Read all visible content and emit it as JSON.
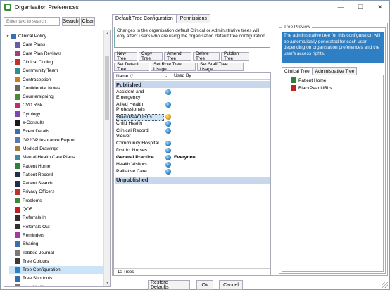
{
  "window": {
    "title": "Organisation Preferences",
    "controls": {
      "minimize": "—",
      "maximize": "☐",
      "close": "✕"
    }
  },
  "left": {
    "search_placeholder": "Enter text to search",
    "search_label": "Search",
    "clear_label": "Clear",
    "tree": [
      {
        "label": "Clinical Policy",
        "color": "#3a6fb0",
        "expand": "▾"
      },
      {
        "label": "Care Plans",
        "color": "#6a5aa8",
        "expand": ""
      },
      {
        "label": "Care Plan Reviews",
        "color": "#a0407a",
        "expand": ""
      },
      {
        "label": "Clinical Coding",
        "color": "#c23030",
        "expand": "›"
      },
      {
        "label": "Community Team",
        "color": "#2f8f8f",
        "expand": ""
      },
      {
        "label": "Contraception",
        "color": "#d07a1a",
        "expand": ""
      },
      {
        "label": "Confidential Notes",
        "color": "#666666",
        "expand": ""
      },
      {
        "label": "Countersigning",
        "color": "#4a8a3a",
        "expand": ""
      },
      {
        "label": "CVD Risk",
        "color": "#c03060",
        "expand": ""
      },
      {
        "label": "Cytology",
        "color": "#7a4ab0",
        "expand": ""
      },
      {
        "label": "e-Consults",
        "color": "#1a1a1a",
        "expand": ""
      },
      {
        "label": "Event Details",
        "color": "#3a6fb0",
        "expand": ""
      },
      {
        "label": "GP2GP Insurance Report",
        "color": "#5a7ab0",
        "expand": ""
      },
      {
        "label": "Medical Drawings",
        "color": "#a07a3a",
        "expand": ""
      },
      {
        "label": "Mental Health Care Plans",
        "color": "#3a8aa0",
        "expand": ""
      },
      {
        "label": "Patient Home",
        "color": "#2f7f3f",
        "expand": ""
      },
      {
        "label": "Patient Record",
        "color": "#20304a",
        "expand": ""
      },
      {
        "label": "Patient Search",
        "color": "#20304a",
        "expand": ""
      },
      {
        "label": "Privacy Officers",
        "color": "#c03030",
        "expand": "›"
      },
      {
        "label": "Problems",
        "color": "#3a8a3a",
        "expand": ""
      },
      {
        "label": "QOF",
        "color": "#c02020",
        "expand": ""
      },
      {
        "label": "Referrals In",
        "color": "#303030",
        "expand": ""
      },
      {
        "label": "Referrals Out",
        "color": "#303030",
        "expand": ""
      },
      {
        "label": "Reminders",
        "color": "#a03aa0",
        "expand": ""
      },
      {
        "label": "Sharing",
        "color": "#3a6fb0",
        "expand": ""
      },
      {
        "label": "Tabbed Journal",
        "color": "#7a7a7a",
        "expand": ""
      },
      {
        "label": "Tree Colours",
        "color": "#3a3a3a",
        "expand": ""
      },
      {
        "label": "Tree Configuration",
        "color": "#2f7fc4",
        "expand": "",
        "selected": true
      },
      {
        "label": "Tree Shortcuts",
        "color": "#2f6fb0",
        "expand": ""
      },
      {
        "label": "Variable Name",
        "color": "#7a7a7a",
        "expand": ""
      }
    ]
  },
  "tabs": {
    "default_tree": "Default Tree Configuration",
    "permissions": "Permissions"
  },
  "info_text": "Changes to the organisation default Clinical or Administrative trees will only affect users who are using the organisation default tree configuration.",
  "actions": {
    "new_tree": "New Tree",
    "copy_tree": "Copy Tree",
    "amend_tree": "Amend Tree",
    "delete_tree": "Delete Tree",
    "publish_tree": "Publish Tree",
    "set_default_tree": "Set Default Tree",
    "set_role_tree_usage": "Set Role Tree Usage",
    "set_staff_tree_usage": "Set Staff Tree Usage"
  },
  "grid": {
    "col_name": "Name",
    "sort_icon": "▽",
    "col_dots": "...",
    "col_used": "Used By",
    "published_label": "Published",
    "unpublished_label": "Unpublished",
    "rows": [
      {
        "name": "Accident and Emergency",
        "used_by": "",
        "bold": false,
        "selected": false,
        "warn": false,
        "lines": 2
      },
      {
        "name": "Allied Health Professionals",
        "used_by": "",
        "bold": false,
        "selected": false,
        "warn": false,
        "lines": 2
      },
      {
        "name": "BlackPear URLs",
        "used_by": "",
        "bold": false,
        "selected": true,
        "warn": true,
        "lines": 1
      },
      {
        "name": "Child Health",
        "used_by": "",
        "bold": false,
        "selected": false,
        "warn": false,
        "lines": 1
      },
      {
        "name": "Clinical Record Viewer",
        "used_by": "",
        "bold": false,
        "selected": false,
        "warn": false,
        "lines": 2
      },
      {
        "name": "Community Hospital",
        "used_by": "",
        "bold": false,
        "selected": false,
        "warn": false,
        "lines": 1
      },
      {
        "name": "District Nurses",
        "used_by": "",
        "bold": false,
        "selected": false,
        "warn": false,
        "lines": 1
      },
      {
        "name": "General Practice",
        "used_by": "Everyone",
        "bold": true,
        "selected": false,
        "warn": false,
        "lines": 1
      },
      {
        "name": "Health Visitors",
        "used_by": "",
        "bold": false,
        "selected": false,
        "warn": false,
        "lines": 1
      },
      {
        "name": "Palliative Care",
        "used_by": "",
        "bold": false,
        "selected": false,
        "warn": false,
        "lines": 1
      }
    ],
    "footer": "10 Trees"
  },
  "preview": {
    "title": "Tree Preview",
    "info": "The administrative tree for this configuration will be automatically generated for each user depending on organisation preferences and the user's access rights.",
    "tab_clinical": "Clinical Tree",
    "tab_admin": "Administrative Tree",
    "items": [
      {
        "label": "Patient Home",
        "color": "#2f7f3f",
        "icon": "patient-home-icon"
      },
      {
        "label": "BlackPear URLs",
        "color": "#c02020",
        "icon": "blackpear-icon"
      }
    ]
  },
  "footer": {
    "restore_defaults": "Restore Defaults",
    "ok": "Ok",
    "cancel": "Cancel"
  }
}
